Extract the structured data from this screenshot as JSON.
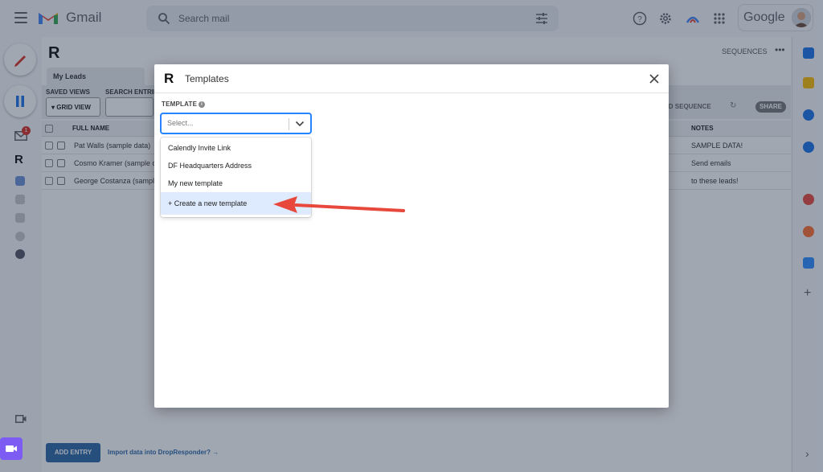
{
  "gmail": {
    "brand": "Gmail",
    "search_placeholder": "Search mail",
    "account_brand": "Google",
    "unread_badge": "1"
  },
  "app": {
    "logo": "R",
    "sequences_link": "SEQUENCES",
    "more": "•••",
    "tab_label": "My Leads",
    "saved_views_label": "SAVED VIEWS",
    "search_entries_label": "SEARCH ENTRIE",
    "grid_view_button": "GRID VIEW",
    "send_sequence_button": "ND SEQUENCE",
    "share_button": "SHARE",
    "columns": {
      "full_name": "FULL NAME",
      "notes": "NOTES"
    },
    "rows": [
      {
        "name": "Pat Walls (sample data)",
        "notes": "SAMPLE DATA!"
      },
      {
        "name": "Cosmo Kramer (sample da",
        "notes": "Send emails"
      },
      {
        "name": "George Costanza (sample",
        "notes": "to these leads!"
      }
    ],
    "add_entry_button": "ADD ENTRY",
    "import_link": "Import data into DropResponder? →"
  },
  "modal": {
    "logo": "R",
    "title": "Templates",
    "field_label": "TEMPLATE",
    "select_placeholder": "Select...",
    "options": [
      {
        "label": "Calendly Invite Link"
      },
      {
        "label": "DF Headquarters Address"
      },
      {
        "label": "My new template"
      },
      {
        "label": "+ Create a new template",
        "highlighted": true
      }
    ]
  },
  "colors": {
    "accent_blue": "#2684ff",
    "highlight": "#deebff",
    "arrow": "#e8473c",
    "add_entry": "#2b68a8"
  }
}
